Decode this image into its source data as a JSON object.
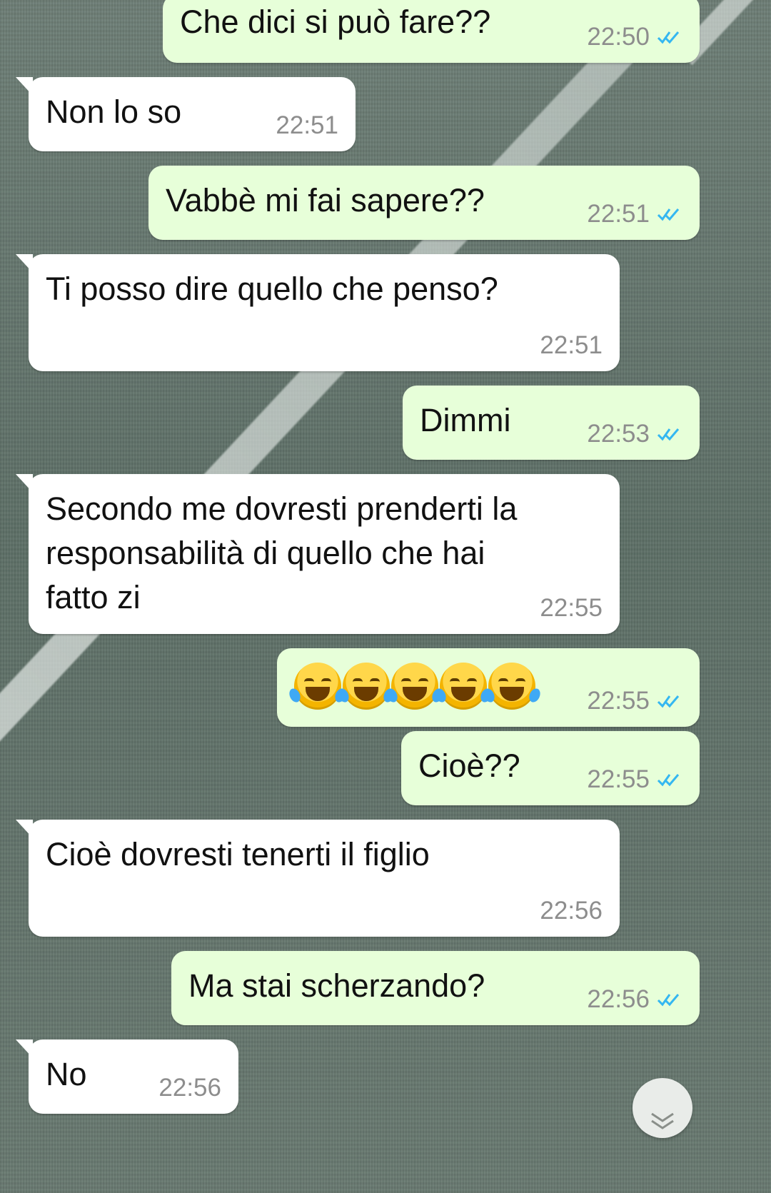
{
  "messages": [
    {
      "id": "m1",
      "dir": "out",
      "text": "Che dici si può fare??",
      "time": "22:50",
      "ticks": "read-double-check-icon"
    },
    {
      "id": "m2",
      "dir": "in",
      "text": "Non lo so",
      "time": "22:51"
    },
    {
      "id": "m3",
      "dir": "out",
      "text": "Vabbè mi fai sapere??",
      "time": "22:51",
      "ticks": "read-double-check-icon"
    },
    {
      "id": "m4",
      "dir": "in",
      "text": "Ti posso dire quello che penso?",
      "time": "22:51"
    },
    {
      "id": "m5",
      "dir": "out",
      "text": "Dimmi",
      "time": "22:53",
      "ticks": "read-double-check-icon"
    },
    {
      "id": "m6",
      "dir": "in",
      "text": "Secondo me dovresti prenderti la\nresponsabilità di quello che hai\nfatto zi",
      "time": "22:55"
    },
    {
      "id": "m7",
      "dir": "out",
      "emoji": [
        "face-with-tears-of-joy",
        "face-with-tears-of-joy",
        "face-with-tears-of-joy",
        "face-with-tears-of-joy",
        "face-with-tears-of-joy"
      ],
      "time": "22:55",
      "ticks": "read-double-check-icon"
    },
    {
      "id": "m8",
      "dir": "out",
      "text": "Cioè??",
      "time": "22:55",
      "ticks": "read-double-check-icon"
    },
    {
      "id": "m9",
      "dir": "in",
      "text": "Cioè dovresti tenerti il figlio",
      "time": "22:56"
    },
    {
      "id": "m10",
      "dir": "out",
      "text": "Ma stai scherzando?",
      "time": "22:56",
      "ticks": "read-double-check-icon"
    },
    {
      "id": "m11",
      "dir": "in",
      "text": "No",
      "time": "22:56"
    }
  ],
  "colors": {
    "incoming_bubble": "#ffffff",
    "outgoing_bubble": "#e7ffd9",
    "read_ticks": "#34b7f1",
    "timestamp": "#8d8d8d"
  },
  "scroll_down_icon": "chevron-double-down-icon"
}
